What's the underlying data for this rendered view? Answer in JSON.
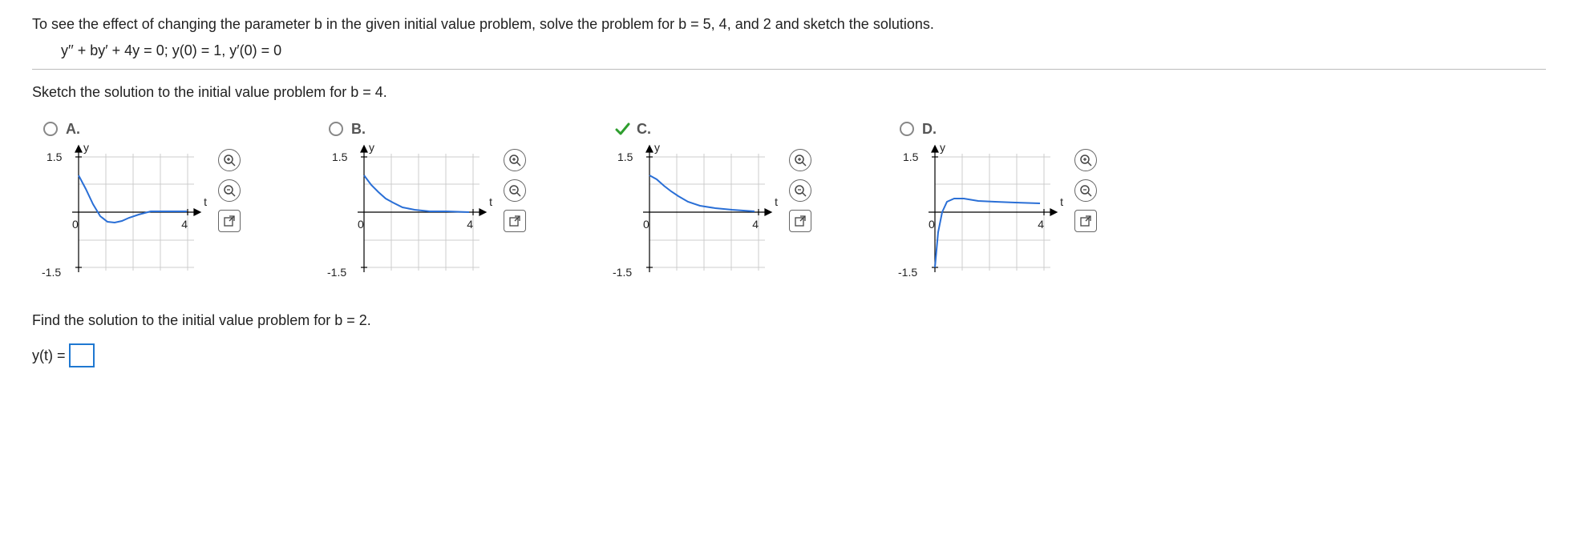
{
  "problem": {
    "statement": "To see the effect of changing the parameter b in the given initial value problem, solve the problem for b = 5, 4, and 2 and sketch the solutions.",
    "equation": "y′′ + by′ + 4y = 0;   y(0) = 1,   y′(0) = 0"
  },
  "sub_prompt": "Sketch the solution to the initial value problem for b = 4.",
  "choices": [
    {
      "label": "A.",
      "selected": false,
      "correct": false
    },
    {
      "label": "B.",
      "selected": false,
      "correct": false
    },
    {
      "label": "C.",
      "selected": true,
      "correct": true
    },
    {
      "label": "D.",
      "selected": false,
      "correct": false
    }
  ],
  "graph_common": {
    "y_label": "y",
    "t_label": "t",
    "y_top": "1.5",
    "y_bot": "-1.5",
    "origin": "0",
    "x_end": "4"
  },
  "chart_data": [
    {
      "type": "line",
      "title": "Option A",
      "xlabel": "t",
      "ylabel": "y",
      "xlim": [
        0,
        4.5
      ],
      "ylim": [
        -1.5,
        1.5
      ],
      "x": [
        0,
        0.3,
        0.6,
        0.9,
        1.2,
        1.5,
        1.8,
        2.1,
        2.5,
        3.0,
        3.6,
        4.3
      ],
      "y": [
        1.0,
        0.62,
        0.21,
        -0.1,
        -0.26,
        -0.29,
        -0.23,
        -0.15,
        -0.06,
        0.02,
        0.03,
        0.01
      ]
    },
    {
      "type": "line",
      "title": "Option B",
      "xlabel": "t",
      "ylabel": "y",
      "xlim": [
        0,
        4.5
      ],
      "ylim": [
        -1.5,
        1.5
      ],
      "x": [
        0,
        0.3,
        0.6,
        0.9,
        1.2,
        1.6,
        2.1,
        2.7,
        3.4,
        4.3
      ],
      "y": [
        1.0,
        0.74,
        0.53,
        0.37,
        0.25,
        0.14,
        0.07,
        0.03,
        0.01,
        0.0
      ]
    },
    {
      "type": "line",
      "title": "Option C",
      "xlabel": "t",
      "ylabel": "y",
      "xlim": [
        0,
        4.5
      ],
      "ylim": [
        -1.5,
        1.5
      ],
      "x": [
        0,
        0.3,
        0.6,
        0.9,
        1.2,
        1.6,
        2.1,
        2.7,
        3.4,
        4.3
      ],
      "y": [
        1.0,
        0.88,
        0.72,
        0.56,
        0.43,
        0.29,
        0.18,
        0.1,
        0.05,
        0.02
      ]
    },
    {
      "type": "line",
      "title": "Option D",
      "xlabel": "t",
      "ylabel": "y",
      "xlim": [
        0,
        4.5
      ],
      "ylim": [
        -1.5,
        1.5
      ],
      "x": [
        0,
        0.15,
        0.3,
        0.5,
        0.8,
        1.2,
        1.8,
        2.5,
        3.3,
        4.3
      ],
      "y": [
        -1.5,
        -0.55,
        0.0,
        0.28,
        0.37,
        0.36,
        0.31,
        0.27,
        0.25,
        0.24
      ]
    }
  ],
  "bottom_prompt": "Find the solution to the initial value problem for b = 2.",
  "answer_label": "y(t) =",
  "answer_value": ""
}
